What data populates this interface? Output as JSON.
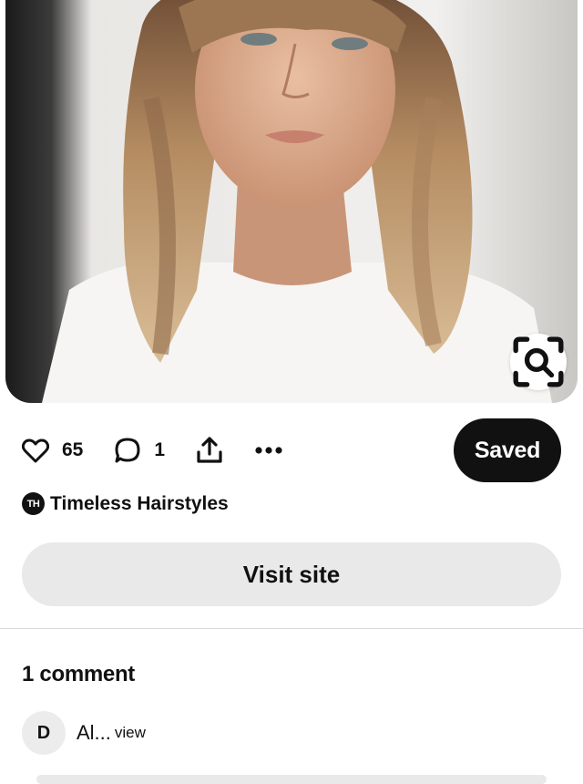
{
  "pin": {
    "image_description_icon": "photo",
    "lens_icon": "visual-search-icon"
  },
  "actions": {
    "like_count": "65",
    "comment_count": "1",
    "saved_label": "Saved"
  },
  "board": {
    "avatar_text": "TH",
    "name": "Timeless Hairstyles"
  },
  "visit": {
    "label": "Visit site"
  },
  "comments": {
    "heading": "1 comment",
    "items": [
      {
        "avatar": "D",
        "text": "Al...",
        "more": "view"
      }
    ]
  }
}
